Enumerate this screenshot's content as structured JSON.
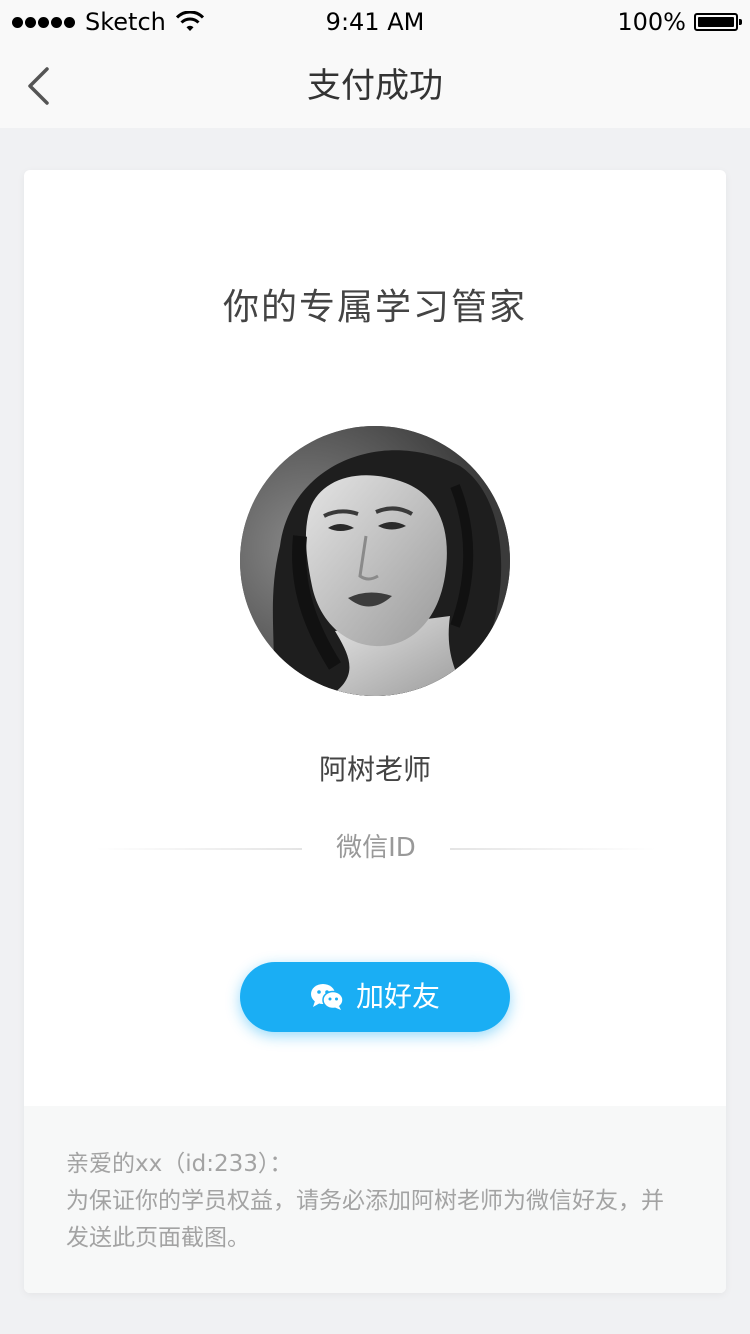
{
  "status_bar": {
    "carrier": "Sketch",
    "time": "9:41 AM",
    "battery": "100%"
  },
  "nav": {
    "title": "支付成功"
  },
  "card": {
    "title": "你的专属学习管家",
    "teacher_name": "阿树老师",
    "wechat_label": "微信ID",
    "add_friend_label": "加好友",
    "notice": {
      "greeting": "亲爱的xx（id:233）：",
      "body": "为保证你的学员权益，请务必添加阿树老师为微信好友，并发送此页面截图。"
    }
  },
  "colors": {
    "accent": "#1aaef4",
    "background": "#f0f1f3",
    "muted_text": "#a3a3a3"
  },
  "icons": {
    "back": "chevron-left-icon",
    "wechat": "wechat-icon",
    "wifi": "wifi-icon",
    "battery": "battery-icon"
  }
}
